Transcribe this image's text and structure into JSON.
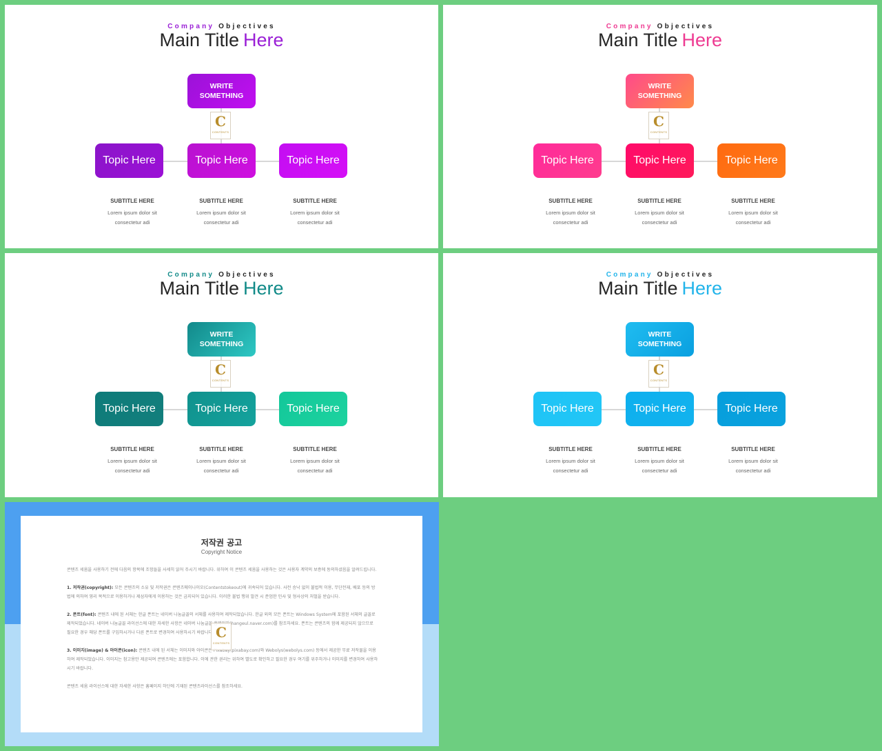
{
  "slides": [
    {
      "eyebrow_a": "Company",
      "eyebrow_b": "Objectives",
      "title_a": "Main Title",
      "title_b": "Here",
      "accent": "#9a1fd6",
      "top_box": "WRITE SOMETHING",
      "top_gradient": [
        "#9b12d8",
        "#c10ff0"
      ],
      "topics": [
        {
          "label": "Topic Here",
          "gradient": [
            "#8a15c9",
            "#9c10d6"
          ]
        },
        {
          "label": "Topic Here",
          "gradient": [
            "#b812d0",
            "#cf0fe0"
          ]
        },
        {
          "label": "Topic Here",
          "gradient": [
            "#c30ef2",
            "#d50ff7"
          ]
        }
      ],
      "subtitles": [
        {
          "title": "SUBTITLE HERE",
          "line1": "Lorem ipsum dolor sit",
          "line2": "consectetur adi"
        },
        {
          "title": "SUBTITLE HERE",
          "line1": "Lorem ipsum dolor sit",
          "line2": "consectetur adi"
        },
        {
          "title": "SUBTITLE HERE",
          "line1": "Lorem ipsum dolor sit",
          "line2": "consectetur adi"
        }
      ]
    },
    {
      "eyebrow_a": "Company",
      "eyebrow_b": "Objectives",
      "title_a": "Main Title",
      "title_b": "Here",
      "accent": "#ee3b92",
      "top_box": "WRITE SOMETHING",
      "top_gradient": [
        "#ff4a8a",
        "#ff8a4a"
      ],
      "topics": [
        {
          "label": "Topic Here",
          "gradient": [
            "#ff2a9a",
            "#ff3c8e"
          ]
        },
        {
          "label": "Topic Here",
          "gradient": [
            "#ff0a6a",
            "#ff1a5a"
          ]
        },
        {
          "label": "Topic Here",
          "gradient": [
            "#ff6a10",
            "#ff7a1a"
          ]
        }
      ],
      "subtitles": [
        {
          "title": "SUBTITLE HERE",
          "line1": "Lorem ipsum dolor sit",
          "line2": "consectetur adi"
        },
        {
          "title": "SUBTITLE HERE",
          "line1": "Lorem ipsum dolor sit",
          "line2": "consectetur adi"
        },
        {
          "title": "SUBTITLE HERE",
          "line1": "Lorem ipsum dolor sit",
          "line2": "consectetur adi"
        }
      ]
    },
    {
      "eyebrow_a": "Company",
      "eyebrow_b": "Objectives",
      "title_a": "Main Title",
      "title_b": "Here",
      "accent": "#118a88",
      "top_box": "WRITE SOMETHING",
      "top_gradient": [
        "#12898a",
        "#2ec8c4"
      ],
      "topics": [
        {
          "label": "Topic Here",
          "gradient": [
            "#0e7b79",
            "#137f7d"
          ]
        },
        {
          "label": "Topic Here",
          "gradient": [
            "#10918d",
            "#14a39d"
          ]
        },
        {
          "label": "Topic Here",
          "gradient": [
            "#13c79a",
            "#1dd39f"
          ]
        }
      ],
      "subtitles": [
        {
          "title": "SUBTITLE HERE",
          "line1": "Lorem ipsum dolor sit",
          "line2": "consectetur adi"
        },
        {
          "title": "SUBTITLE HERE",
          "line1": "Lorem ipsum dolor sit",
          "line2": "consectetur adi"
        },
        {
          "title": "SUBTITLE HERE",
          "line1": "Lorem ipsum dolor sit",
          "line2": "consectetur adi"
        }
      ]
    },
    {
      "eyebrow_a": "Company",
      "eyebrow_b": "Objectives",
      "title_a": "Main Title",
      "title_b": "Here",
      "accent": "#22b4ea",
      "top_box": "WRITE SOMETHING",
      "top_gradient": [
        "#1fbcf0",
        "#0aa0e0"
      ],
      "topics": [
        {
          "label": "Topic Here",
          "gradient": [
            "#1ec4f6",
            "#22c6f6"
          ]
        },
        {
          "label": "Topic Here",
          "gradient": [
            "#0eb0ee",
            "#12b2ee"
          ]
        },
        {
          "label": "Topic Here",
          "gradient": [
            "#069edc",
            "#0aa2de"
          ]
        }
      ],
      "subtitles": [
        {
          "title": "SUBTITLE HERE",
          "line1": "Lorem ipsum dolor sit",
          "line2": "consectetur adi"
        },
        {
          "title": "SUBTITLE HERE",
          "line1": "Lorem ipsum dolor sit",
          "line2": "consectetur adi"
        },
        {
          "title": "SUBTITLE HERE",
          "line1": "Lorem ipsum dolor sit",
          "line2": "consectetur adi"
        }
      ]
    }
  ],
  "logo": {
    "glyph": "C",
    "text": "CONTENTS"
  },
  "copyright": {
    "title_ko": "저작권 공고",
    "title_en": "Copyright Notice",
    "intro": "콘텐츠 세움을 사용하기 전에 다음의 항목에 조항들을 사세히 읽어 주시기 바랍니다. 위하여 이 콘텐츠 세움을 사용하는 것은 사용자 계약의 보증에 동의하셨음을 알려드립니다.",
    "item1_head": "1. 저작권(copyright):",
    "item1": " 모든 콘텐츠의 소유 및 저작권은 콘텐츠메이나이오(Contentstokeout)에 귀속되어 있습니다. 사전 승낙 없이 불법적 이용, 무단전재, 배포 등의 방법에 의하여 영리 목적으로 이용하거나 제삼자에게 이용하는 것은 금지되어 있습니다. 이러한 불법 행위 발견 시 준엄한 민사 및 형사상의 처벌을 받습니다.",
    "item2_head": "2. 폰트(font):",
    "item2": " 콘텐츠 내에 된 서체는 한글 폰트는 네이버 나눔글꼴의 서체를 사용하여 제작되었습니다. 한글 외의 모든 폰트는 Windows System에 포함된 서체의 글꼴로 제작되었습니다. 네이버 나눔글꼴 라이선스에 대한 자세한 사항은 네이버 나눔글꼴 홈페이지(hangeul.naver.com)를 참조하세요. 폰트는 콘텐츠의 함께 제공되지 않으므로 필요한 경우 해당 폰트를 구입하시거나 다른 폰트로 변경하여 사용하시기 바랍니다.",
    "item3_head": "3. 이미지(image) & 아이콘(icon):",
    "item3": " 콘텐츠 내에 된 서체는 이미지와 아이콘은 Pixabay(pixabay.com)와 Webolys(webolys.com) 등에서 제공한 무료 저작물을 이용하여 제작되었습니다. 이미지는 참고용만 제공되며 콘텐츠에는 포함합니다. 이에 관한 권리는 위하여 별도로 확인하고 필요한 경우 여기를 위주하거나 이미지를 변경하여 사용하시기 바랍니다.",
    "outro": "콘텐츠 세움 라이선스에 대한 자세한 사항은 홈페이지 하단에 기재된 콘텐츠라이선스를 참조하세요."
  }
}
